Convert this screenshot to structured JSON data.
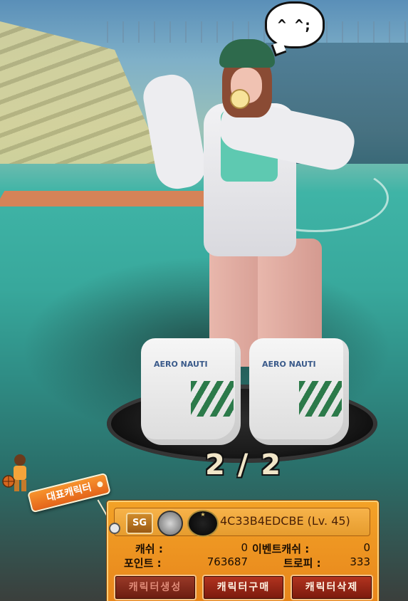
{
  "speech_bubble": "^ ^;",
  "pager": {
    "text": "2 / 2"
  },
  "rep_tag": {
    "label": "대표캐릭터"
  },
  "shoe_label": "AERO NAUTI",
  "character": {
    "position_badge": "SG",
    "name_level": "4C33B4EDCBE (Lv. 45)"
  },
  "stats": {
    "cash_label": "캐쉬 :",
    "cash_value": "0",
    "event_cash_label": "이벤트캐쉬 :",
    "event_cash_value": "0",
    "points_label": "포인트 :",
    "points_value": "763687",
    "trophy_label": "트로피 :",
    "trophy_value": "333"
  },
  "buttons": {
    "create": "캐릭터생성",
    "buy": "캐릭터구매",
    "delete": "캐릭터삭제"
  }
}
